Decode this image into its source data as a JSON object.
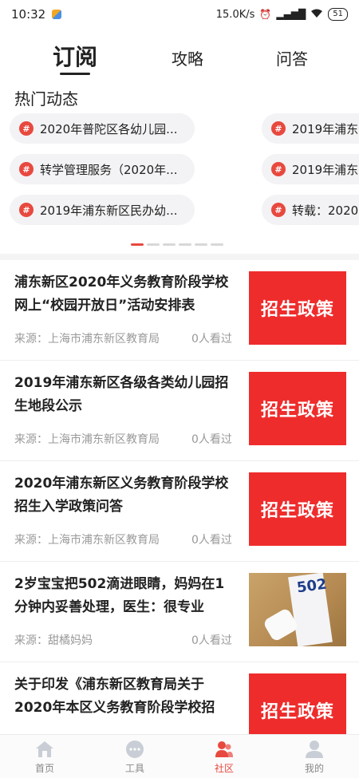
{
  "status_bar": {
    "time": "10:32",
    "speed": "15.0K/s",
    "battery": "51"
  },
  "tabs": [
    {
      "label": "订阅",
      "active": true
    },
    {
      "label": "攻略",
      "active": false
    },
    {
      "label": "问答",
      "active": false
    }
  ],
  "hot": {
    "title": "热门动态",
    "hash_symbol": "#",
    "items": [
      "2020年普陀区各幼儿园...",
      "转学管理服务（2020年...",
      "2019年浦东新区民办幼...",
      "2019年浦东",
      "2019年浦东",
      "转载：2020"
    ],
    "page_count": 6,
    "active_page": 0
  },
  "articles": [
    {
      "title": "浦东新区2020年义务教育阶段学校网上“校园开放日”活动安排表",
      "source": "来源：上海市浦东新区教育局",
      "views": "0人看过",
      "thumb_type": "policy",
      "thumb_text": "招生政策"
    },
    {
      "title": "2019年浦东新区各级各类幼儿园招生地段公示",
      "source": "来源：上海市浦东新区教育局",
      "views": "0人看过",
      "thumb_type": "policy",
      "thumb_text": "招生政策"
    },
    {
      "title": "2020年浦东新区义务教育阶段学校招生入学政策问答",
      "source": "来源：上海市浦东新区教育局",
      "views": "0人看过",
      "thumb_type": "policy",
      "thumb_text": "招生政策"
    },
    {
      "title": "2岁宝宝把502滴进眼睛，妈妈在1分钟内妥善处理，医生：很专业",
      "source": "来源：甜橘妈妈",
      "views": "0人看过",
      "thumb_type": "photo",
      "thumb_text": "502"
    },
    {
      "title": "关于印发《浦东新区教育局关于2020年本区义务教育阶段学校招",
      "source": "",
      "views": "",
      "thumb_type": "policy",
      "thumb_text": "招生政策"
    }
  ],
  "bottom_nav": [
    {
      "label": "首页",
      "icon": "home-icon",
      "active": false
    },
    {
      "label": "工具",
      "icon": "tools-icon",
      "active": false
    },
    {
      "label": "社区",
      "icon": "community-icon",
      "active": true
    },
    {
      "label": "我的",
      "icon": "profile-icon",
      "active": false
    }
  ],
  "colors": {
    "accent": "#e8493f",
    "policy_bg": "#ef2c2c",
    "muted_text": "#999999"
  }
}
